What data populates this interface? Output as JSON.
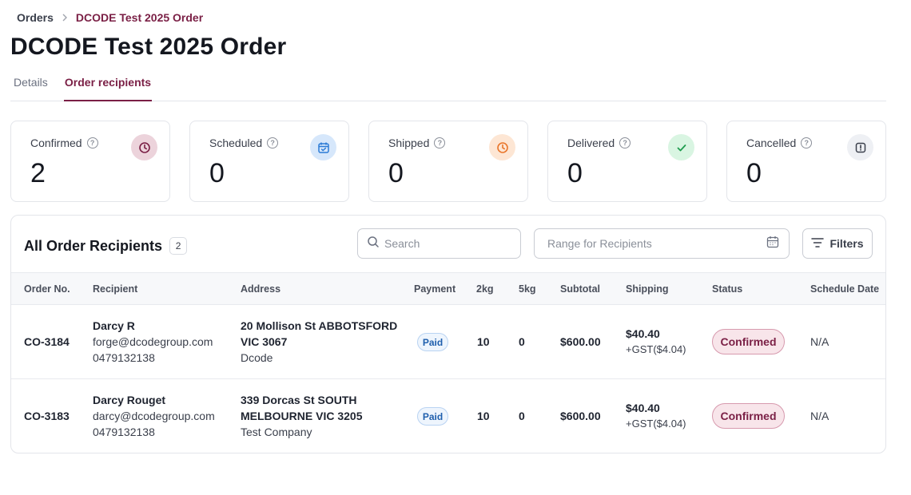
{
  "breadcrumb": {
    "root": "Orders",
    "current": "DCODE Test 2025 Order"
  },
  "page": {
    "title": "DCODE Test 2025 Order"
  },
  "tabs": [
    {
      "label": "Details",
      "active": false
    },
    {
      "label": "Order recipients",
      "active": true
    }
  ],
  "stats": [
    {
      "label": "Confirmed",
      "value": "2",
      "icon": "clock-icon",
      "color": "#7a1f45"
    },
    {
      "label": "Scheduled",
      "value": "0",
      "icon": "calendar-check-icon",
      "color": "#2b7bd6"
    },
    {
      "label": "Shipped",
      "value": "0",
      "icon": "clock-icon",
      "color": "#e9762b"
    },
    {
      "label": "Delivered",
      "value": "0",
      "icon": "check-icon",
      "color": "#1f9d4f"
    },
    {
      "label": "Cancelled",
      "value": "0",
      "icon": "alert-square-icon",
      "color": "#3a3f4b"
    }
  ],
  "recipients_panel": {
    "title": "All Order Recipients",
    "count": "2",
    "search_placeholder": "Search",
    "range_placeholder": "Range for Recipients",
    "filters_label": "Filters"
  },
  "table": {
    "headers": [
      "Order No.",
      "Recipient",
      "Address",
      "Payment",
      "2kg",
      "5kg",
      "Subtotal",
      "Shipping",
      "Status",
      "Schedule Date"
    ],
    "rows": [
      {
        "order_no": "CO-3184",
        "name": "Darcy R",
        "email": "forge@dcodegroup.com",
        "phone": "0479132138",
        "address_line1": "20 Mollison St ABBOTSFORD",
        "address_line2": "VIC 3067",
        "company": "Dcode",
        "payment": "Paid",
        "qty_2kg": "10",
        "qty_5kg": "0",
        "subtotal": "$600.00",
        "shipping": "$40.40",
        "gst": "+GST($4.04)",
        "status": "Confirmed",
        "schedule_date": "N/A"
      },
      {
        "order_no": "CO-3183",
        "name": "Darcy Rouget",
        "email": "darcy@dcodegroup.com",
        "phone": "0479132138",
        "address_line1": "339 Dorcas St SOUTH",
        "address_line2": "MELBOURNE VIC 3205",
        "company": "Test Company",
        "payment": "Paid",
        "qty_2kg": "10",
        "qty_5kg": "0",
        "subtotal": "$600.00",
        "shipping": "$40.40",
        "gst": "+GST($4.04)",
        "status": "Confirmed",
        "schedule_date": "N/A"
      }
    ]
  }
}
